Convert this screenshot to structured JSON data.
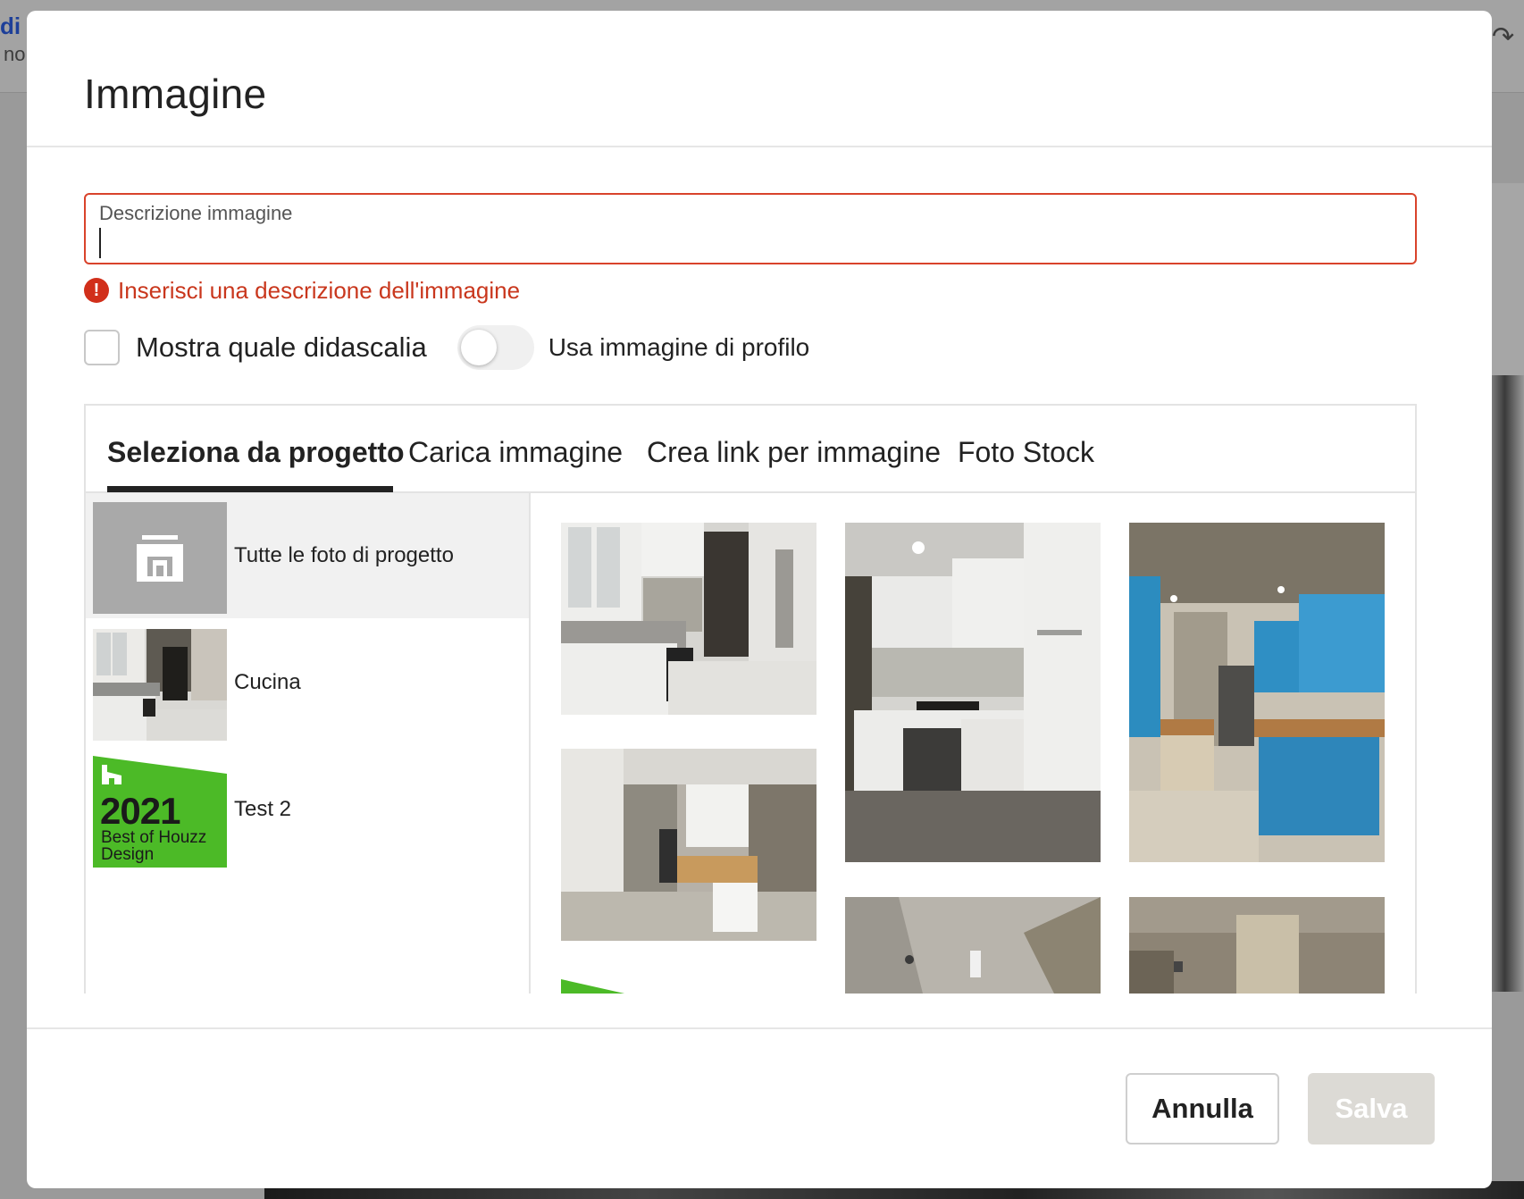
{
  "background": {
    "link_text": "di u",
    "sub_text": "no",
    "redo_icon": "redo-arrow-icon"
  },
  "modal": {
    "title": "Immagine",
    "description_field": {
      "label": "Descrizione immagine",
      "value": "",
      "error": "Inserisci una descrizione dell'immagine",
      "error_color": "#d12f1a"
    },
    "caption_checkbox": {
      "label": "Mostra quale didascalia",
      "checked": false
    },
    "profile_toggle": {
      "label": "Usa immagine di profilo",
      "on": false
    },
    "tabs": [
      {
        "label": "Seleziona da progetto",
        "active": true
      },
      {
        "label": "Carica immagine",
        "active": false
      },
      {
        "label": "Crea link per immagine",
        "active": false
      },
      {
        "label": "Foto Stock",
        "active": false
      }
    ],
    "albums": [
      {
        "name": "Tutte le foto di progetto",
        "thumb": "album-icon",
        "selected": true
      },
      {
        "name": "Cucina",
        "thumb": "kitchen-photo",
        "selected": false
      },
      {
        "name": "Test 2",
        "thumb": "houzz-badge",
        "selected": false
      }
    ],
    "badge": {
      "year": "2021",
      "line1": "Best of Houzz",
      "line2": "Design",
      "color": "#4cba27"
    },
    "footer": {
      "cancel_label": "Annulla",
      "save_label": "Salva"
    }
  }
}
